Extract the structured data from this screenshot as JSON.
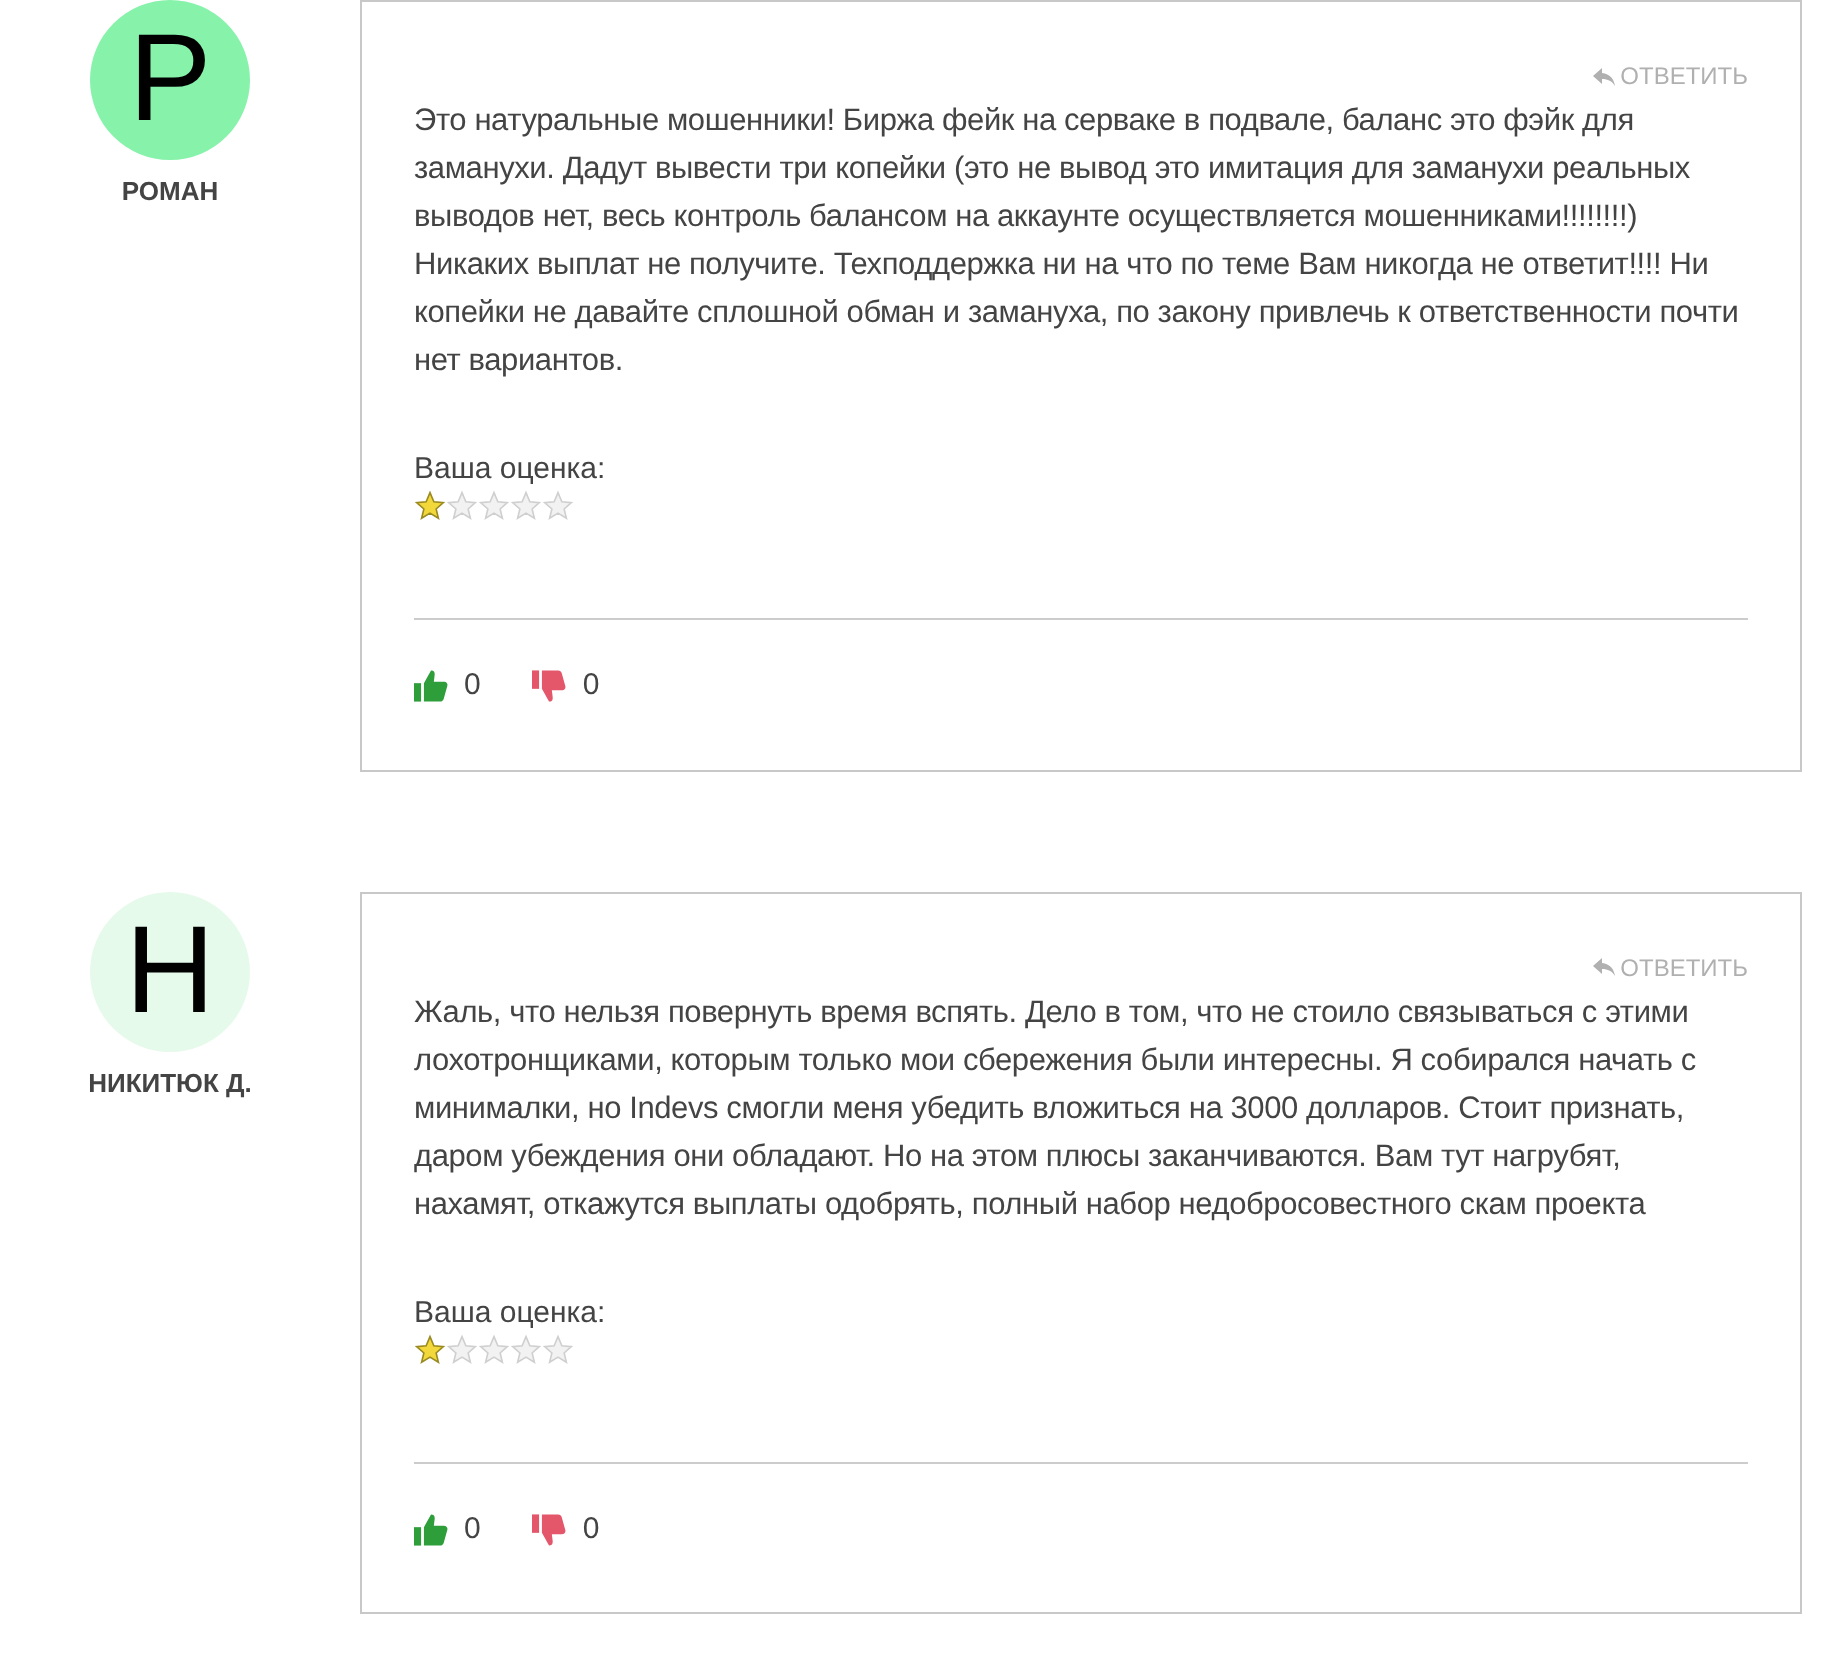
{
  "comments": [
    {
      "initial": "Р",
      "color": "#86f2aa",
      "author": "РОМАН",
      "reply": "ОТВЕТИТЬ",
      "text": "Это натуральные мошенники! Биржа фейк на серваке в подвале, баланс это фэйк для заманухи. Дадут вывести три копейки (это не вывод это имитация для заманухи реальных выводов нет, весь контроль балансом на аккаунте осуществляется мошенниками!!!!!!!!) Никаких выплат не получите. Техподдержка ни на что по теме Вам никогда не ответит!!!! Ни копейки не давайте сплошной обман и замануха, по закону привлечь к ответственности почти нет вариантов.",
      "rating_label": "Ваша оценка:",
      "stars": 1,
      "likes": "0",
      "dislikes": "0"
    },
    {
      "initial": "Н",
      "color": "#e6faeb",
      "author": "НИКИТЮК Д.",
      "reply": "ОТВЕТИТЬ",
      "text": "Жаль, что нельзя повернуть время вспять. Дело в том, что не стоило связываться с этими лохотронщиками, которым только мои сбережения были интересны. Я собирался начать с минималки, но Indevs смогли меня убедить вложиться на 3000 долларов. Стоит признать, даром убеждения они обладают. Но на этом плюсы заканчиваются. Вам тут нагрубят, нахамят, откажутся выплаты одобрять, полный набор недобросовестного скам проекта",
      "rating_label": "Ваша оценка:",
      "stars": 1,
      "likes": "0",
      "dislikes": "0"
    }
  ]
}
